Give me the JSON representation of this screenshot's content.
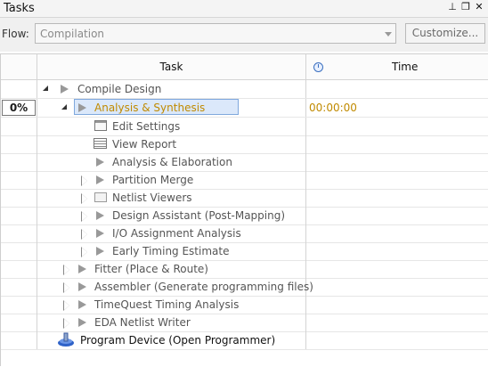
{
  "panel": {
    "title": "Tasks"
  },
  "flow": {
    "label": "Flow:",
    "value": "Compilation",
    "customize_label": "Customize..."
  },
  "table": {
    "headers": {
      "task": "Task",
      "time": "Time"
    },
    "progress": "0%",
    "rows": [
      {
        "label": "Compile Design",
        "time": ""
      },
      {
        "label": "Analysis & Synthesis",
        "time": "00:00:00"
      },
      {
        "label": "Edit Settings",
        "time": ""
      },
      {
        "label": "View Report",
        "time": ""
      },
      {
        "label": "Analysis & Elaboration",
        "time": ""
      },
      {
        "label": "Partition Merge",
        "time": ""
      },
      {
        "label": "Netlist Viewers",
        "time": ""
      },
      {
        "label": "Design Assistant (Post-Mapping)",
        "time": ""
      },
      {
        "label": "I/O Assignment Analysis",
        "time": ""
      },
      {
        "label": "Early Timing Estimate",
        "time": ""
      },
      {
        "label": "Fitter (Place & Route)",
        "time": ""
      },
      {
        "label": "Assembler (Generate programming files)",
        "time": ""
      },
      {
        "label": "TimeQuest Timing Analysis",
        "time": ""
      },
      {
        "label": "EDA Netlist Writer",
        "time": ""
      },
      {
        "label": "Program Device (Open Programmer)",
        "time": ""
      }
    ]
  },
  "colors": {
    "selection": "#dbe8fa",
    "time_text": "#c08a00"
  }
}
